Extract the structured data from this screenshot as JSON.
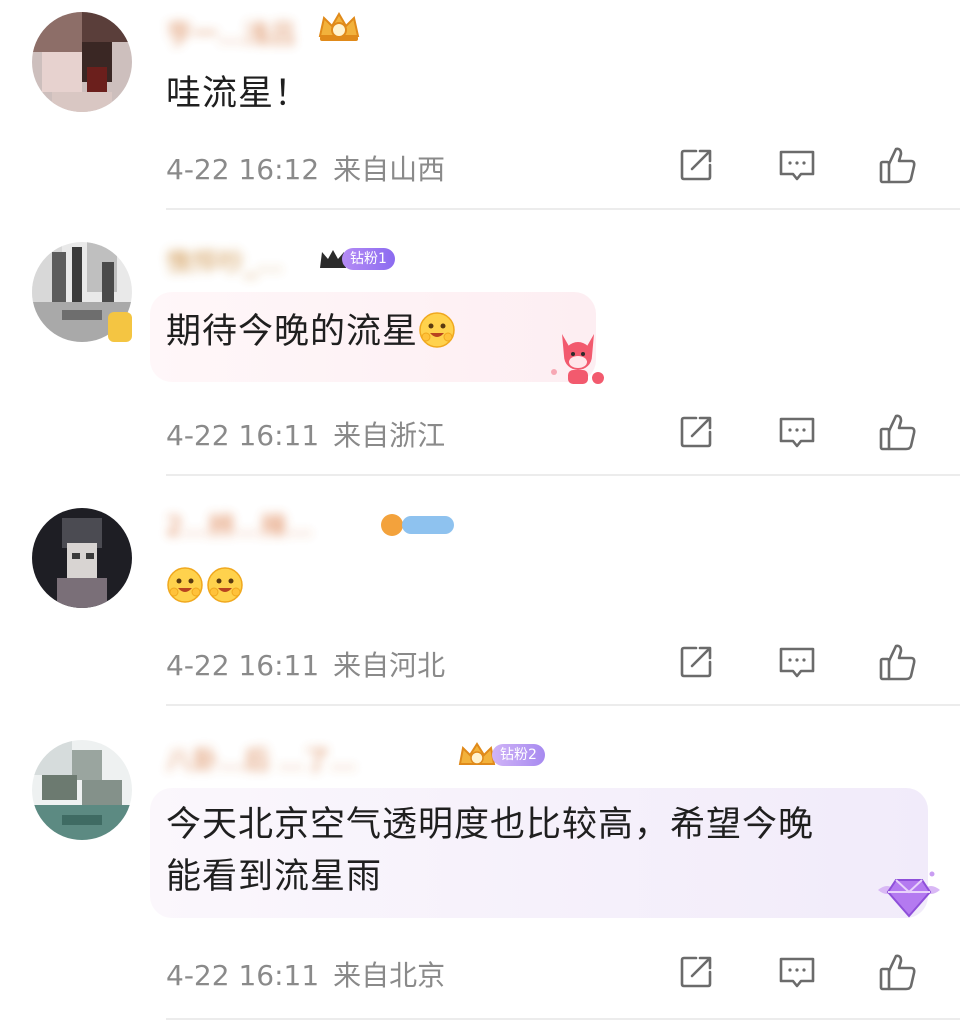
{
  "comments": [
    {
      "username": "亨一…浅吕",
      "text": "哇流星！",
      "time": "4-22 16:12",
      "location": "来自山西",
      "badge": ""
    },
    {
      "username": "憔悴吵_…",
      "text": "期待今晚的流星",
      "time": "4-22 16:11",
      "location": "来自浙江",
      "badge": "钻粉1"
    },
    {
      "username": "2…辨…辣…",
      "text": "",
      "time": "4-22 16:11",
      "location": "来自河北",
      "badge": ""
    },
    {
      "username": "八卦…后 …了…",
      "text_line1": "今天北京空气透明度也比较高，希望今晚",
      "text_line2": "能看到流星雨",
      "time": "4-22 16:11",
      "location": "来自北京",
      "badge": "钻粉2"
    }
  ],
  "icons": {
    "share": "share-icon",
    "reply": "comment-icon",
    "like": "thumbs-up-icon"
  },
  "colors": {
    "meta_text": "#8a8a8a",
    "icon_stroke": "#6b6b6b",
    "divider": "#ececec",
    "bubble_pink": "#fdf0f3",
    "bubble_purple": "#f3ecfb"
  }
}
